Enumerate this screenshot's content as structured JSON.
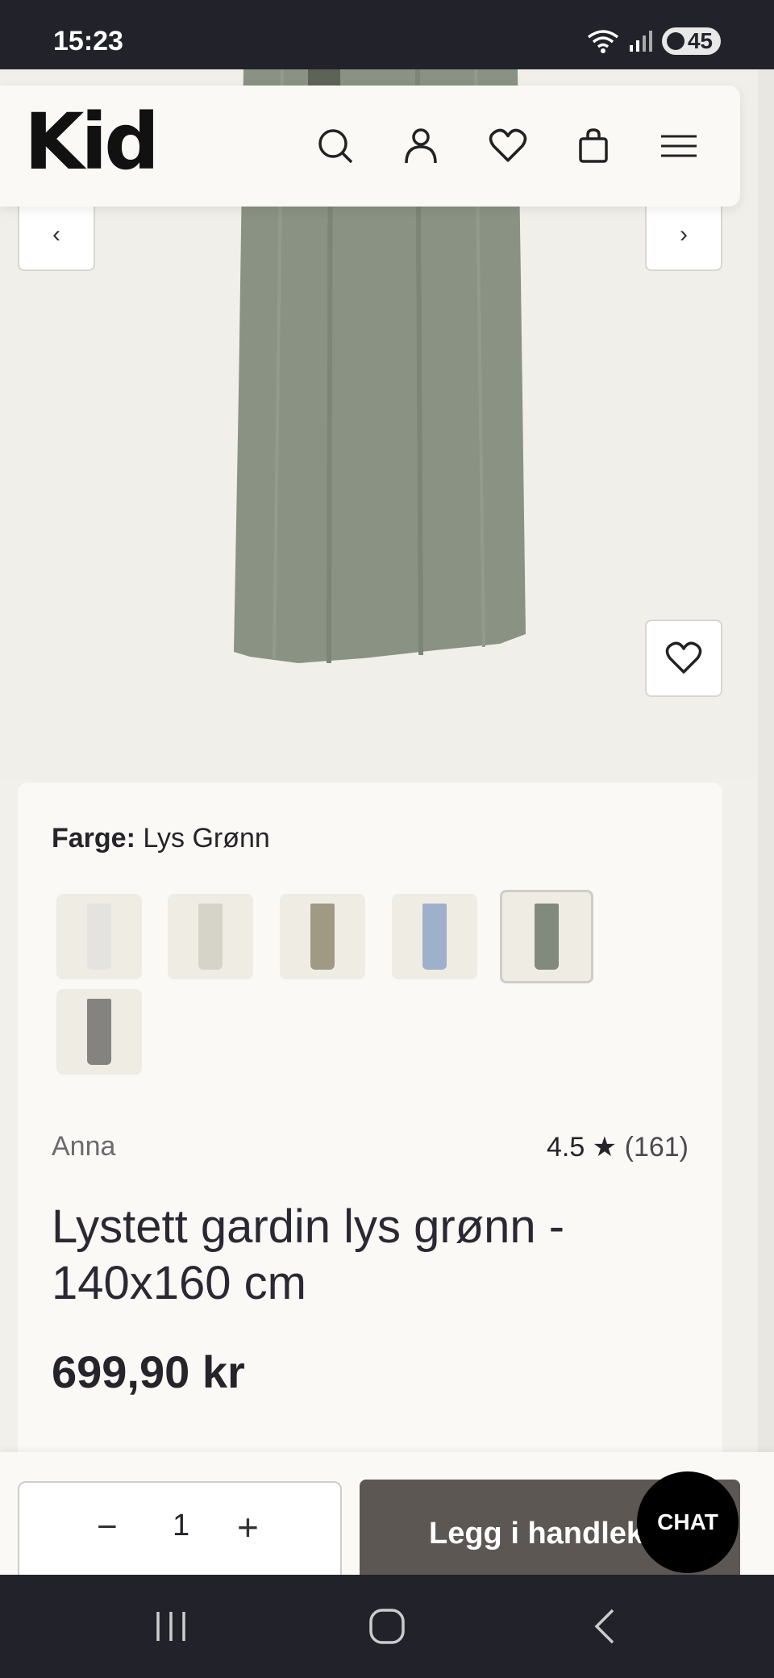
{
  "status_bar": {
    "time": "15:23",
    "battery": "45",
    "icons": [
      "wifi-icon",
      "signal-icon",
      "battery-icon"
    ]
  },
  "header": {
    "logo": "Kid",
    "icons": [
      "search-icon",
      "account-icon",
      "wishlist-icon",
      "cart-icon",
      "menu-icon"
    ]
  },
  "gallery": {
    "prev": "‹",
    "next": "›"
  },
  "product": {
    "color_label": "Farge:",
    "color_value": "Lys Grønn",
    "swatches": [
      {
        "name": "white",
        "color": "#e4e3e0",
        "selected": false
      },
      {
        "name": "light-beige",
        "color": "#d6d3c8",
        "selected": false
      },
      {
        "name": "khaki",
        "color": "#a09a84",
        "selected": false
      },
      {
        "name": "light-blue",
        "color": "#9fb0cc",
        "selected": false
      },
      {
        "name": "light-green",
        "color": "#828a7d",
        "selected": true
      },
      {
        "name": "grey",
        "color": "#858380",
        "selected": false
      }
    ],
    "brand": "Anna",
    "rating_value": "4.5 ★",
    "rating_count": "(161)",
    "title": "Lystett gardin lys grønn - 140x160 cm",
    "price": "699,90 kr"
  },
  "purchase": {
    "quantity": "1",
    "minus": "−",
    "plus": "+",
    "add_label": "Legg i handlekurv",
    "chat_label": "CHAT"
  },
  "colors": {
    "curtain": "#8a9283",
    "button_dark": "#5d5753",
    "background": "#f2f0ea"
  }
}
